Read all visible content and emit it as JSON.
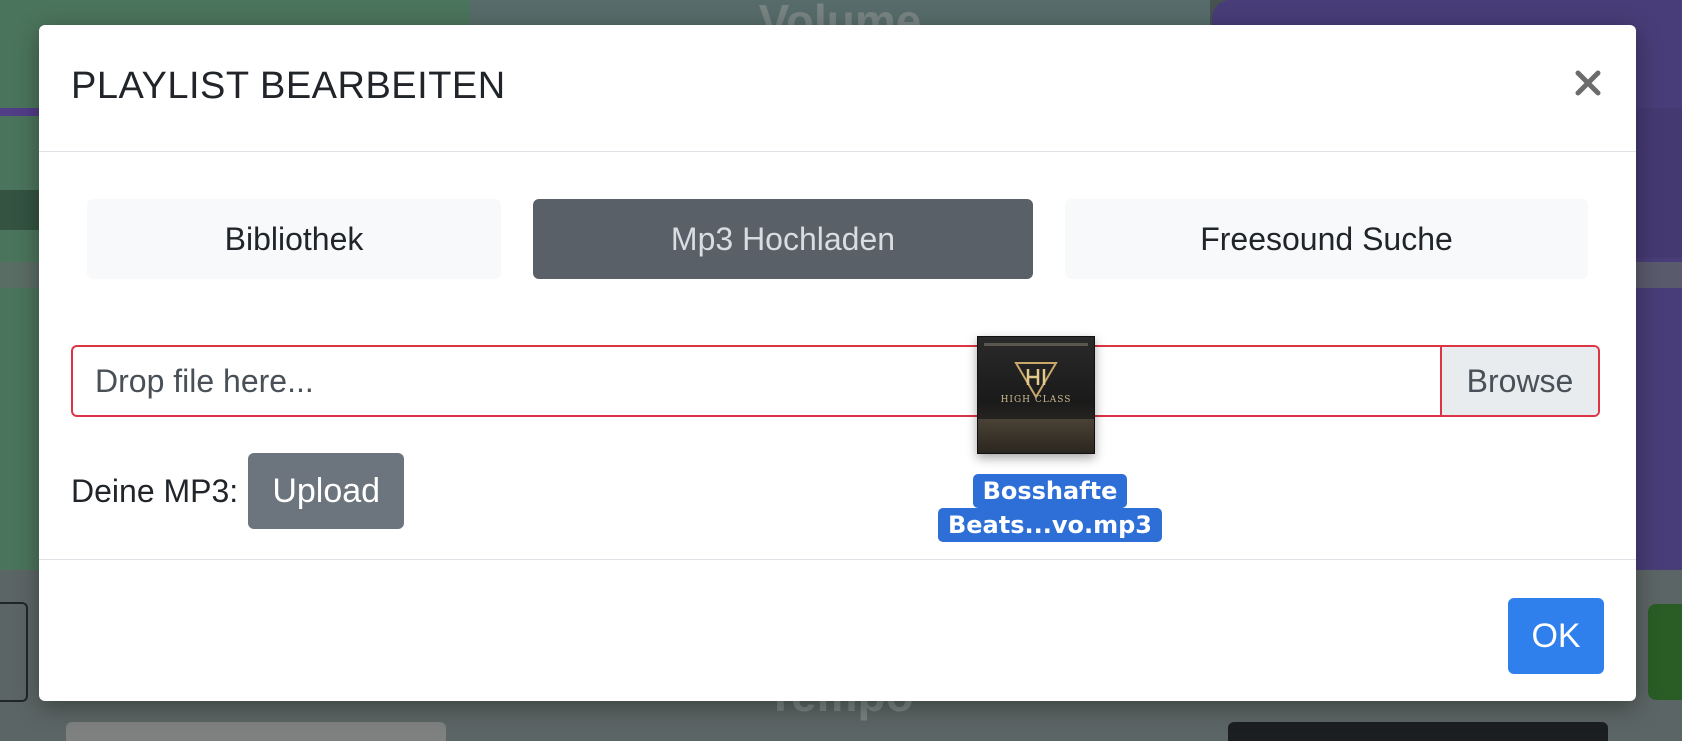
{
  "background": {
    "volume_label": "Volume",
    "tempo_label": "Tempo"
  },
  "modal": {
    "title": "PLAYLIST BEARBEITEN",
    "close_icon": "close-icon",
    "tabs": [
      {
        "label": "Bibliothek",
        "active": false
      },
      {
        "label": "Mp3 Hochladen",
        "active": true
      },
      {
        "label": "Freesound Suche",
        "active": false
      }
    ],
    "file_input": {
      "placeholder": "Drop file here...",
      "browse_label": "Browse",
      "state": "invalid"
    },
    "mp3_label": "Deine MP3:",
    "upload_label": "Upload",
    "ok_label": "OK"
  },
  "drag_file": {
    "name_line1": "Bosshafte",
    "name_line2": "Beats...vo.mp3",
    "thumb_text": "HIGH CLASS"
  },
  "colors": {
    "accent_blue": "#2f80ed",
    "active_tab": "#5a6068",
    "invalid_border": "#dc3545",
    "selection_blue": "#2d6fd6"
  }
}
